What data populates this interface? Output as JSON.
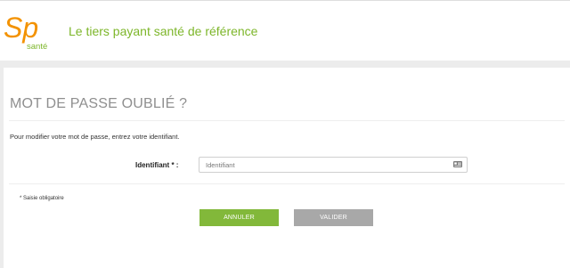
{
  "header": {
    "logo": {
      "letters": "Sp",
      "subtitle": "santé"
    },
    "tagline": "Le tiers payant santé de référence"
  },
  "page": {
    "title": "MOT DE PASSE OUBLIÉ ?",
    "instruction": "Pour modifier votre mot de passe, entrez votre identifiant."
  },
  "form": {
    "identifier": {
      "label": "Identifiant * :",
      "placeholder": "Identifiant",
      "value": "",
      "icon": "id-card-icon"
    },
    "required_note": "* Saisie obligatoire"
  },
  "actions": {
    "cancel_label": "ANNULER",
    "validate_label": "VALIDER"
  },
  "colors": {
    "brand_orange": "#f39200",
    "brand_green": "#7db62a",
    "cancel_button": "#82b83a",
    "validate_button": "#a8a8a8",
    "title_gray": "#8f8f8f",
    "page_background": "#ececec"
  }
}
